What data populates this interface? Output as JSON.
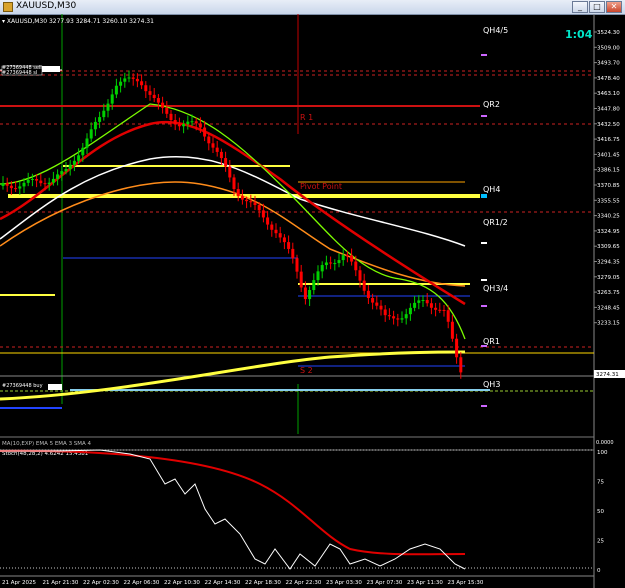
{
  "window": {
    "title": "XAUUSD,M30",
    "buttons": [
      "_",
      "□",
      "✕"
    ]
  },
  "chart": {
    "info": "▾ XAUUSD,M30  3277.93 3284.71 3260.10 3274.31",
    "timer": "1:04",
    "order_labels": [
      "#27369448 sell",
      "#27369448 sl"
    ],
    "entry_label": "#27369448 buy",
    "pivots": {
      "r1": "R 1",
      "pivot": "Pivot Point",
      "s2": "S 2"
    },
    "levels": {
      "qh45": "QH4/5",
      "qr2": "QR2",
      "qh4": "QH4",
      "qr12": "QR1/2",
      "qh34": "QH3/4",
      "qr1": "QR1",
      "qh3": "QH3"
    },
    "price_axis": [
      "3524.30",
      "3509.00",
      "3493.70",
      "3478.40",
      "3463.10",
      "3447.80",
      "3432.50",
      "3416.75",
      "3401.45",
      "3386.15",
      "3370.85",
      "3355.55",
      "3340.25",
      "3324.95",
      "3309.65",
      "3294.35",
      "3279.05",
      "3263.75",
      "3248.45",
      "3233.15"
    ],
    "current_price": "3274.31",
    "indicator_label": "MA(10,EXP) EMA 5 EMA 3 SMA 4",
    "stoch_label": "Stoch(48,28,2) 4.6242 15.4381",
    "stoch_axis": [
      "100",
      "75",
      "50",
      "25",
      "0"
    ],
    "stoch_right_top": "0.0000",
    "time_axis": [
      "21 Apr 2025",
      "21 Apr 21:30",
      "22 Apr 02:30",
      "22 Apr 06:30",
      "22 Apr 10:30",
      "22 Apr 14:30",
      "22 Apr 18:30",
      "22 Apr 22:30",
      "23 Apr 03:30",
      "23 Apr 07:30",
      "23 Apr 11:30",
      "23 Apr 15:30"
    ],
    "colors": {
      "bull": "#00d000",
      "bear": "#ff0000",
      "yellow": "#ffff40",
      "red_ma": "#e00000",
      "green_ma": "#7cfc00",
      "white_ma": "#ffffff",
      "orange_ma": "#ff8c1a",
      "timer": "#00e5c8"
    }
  }
}
